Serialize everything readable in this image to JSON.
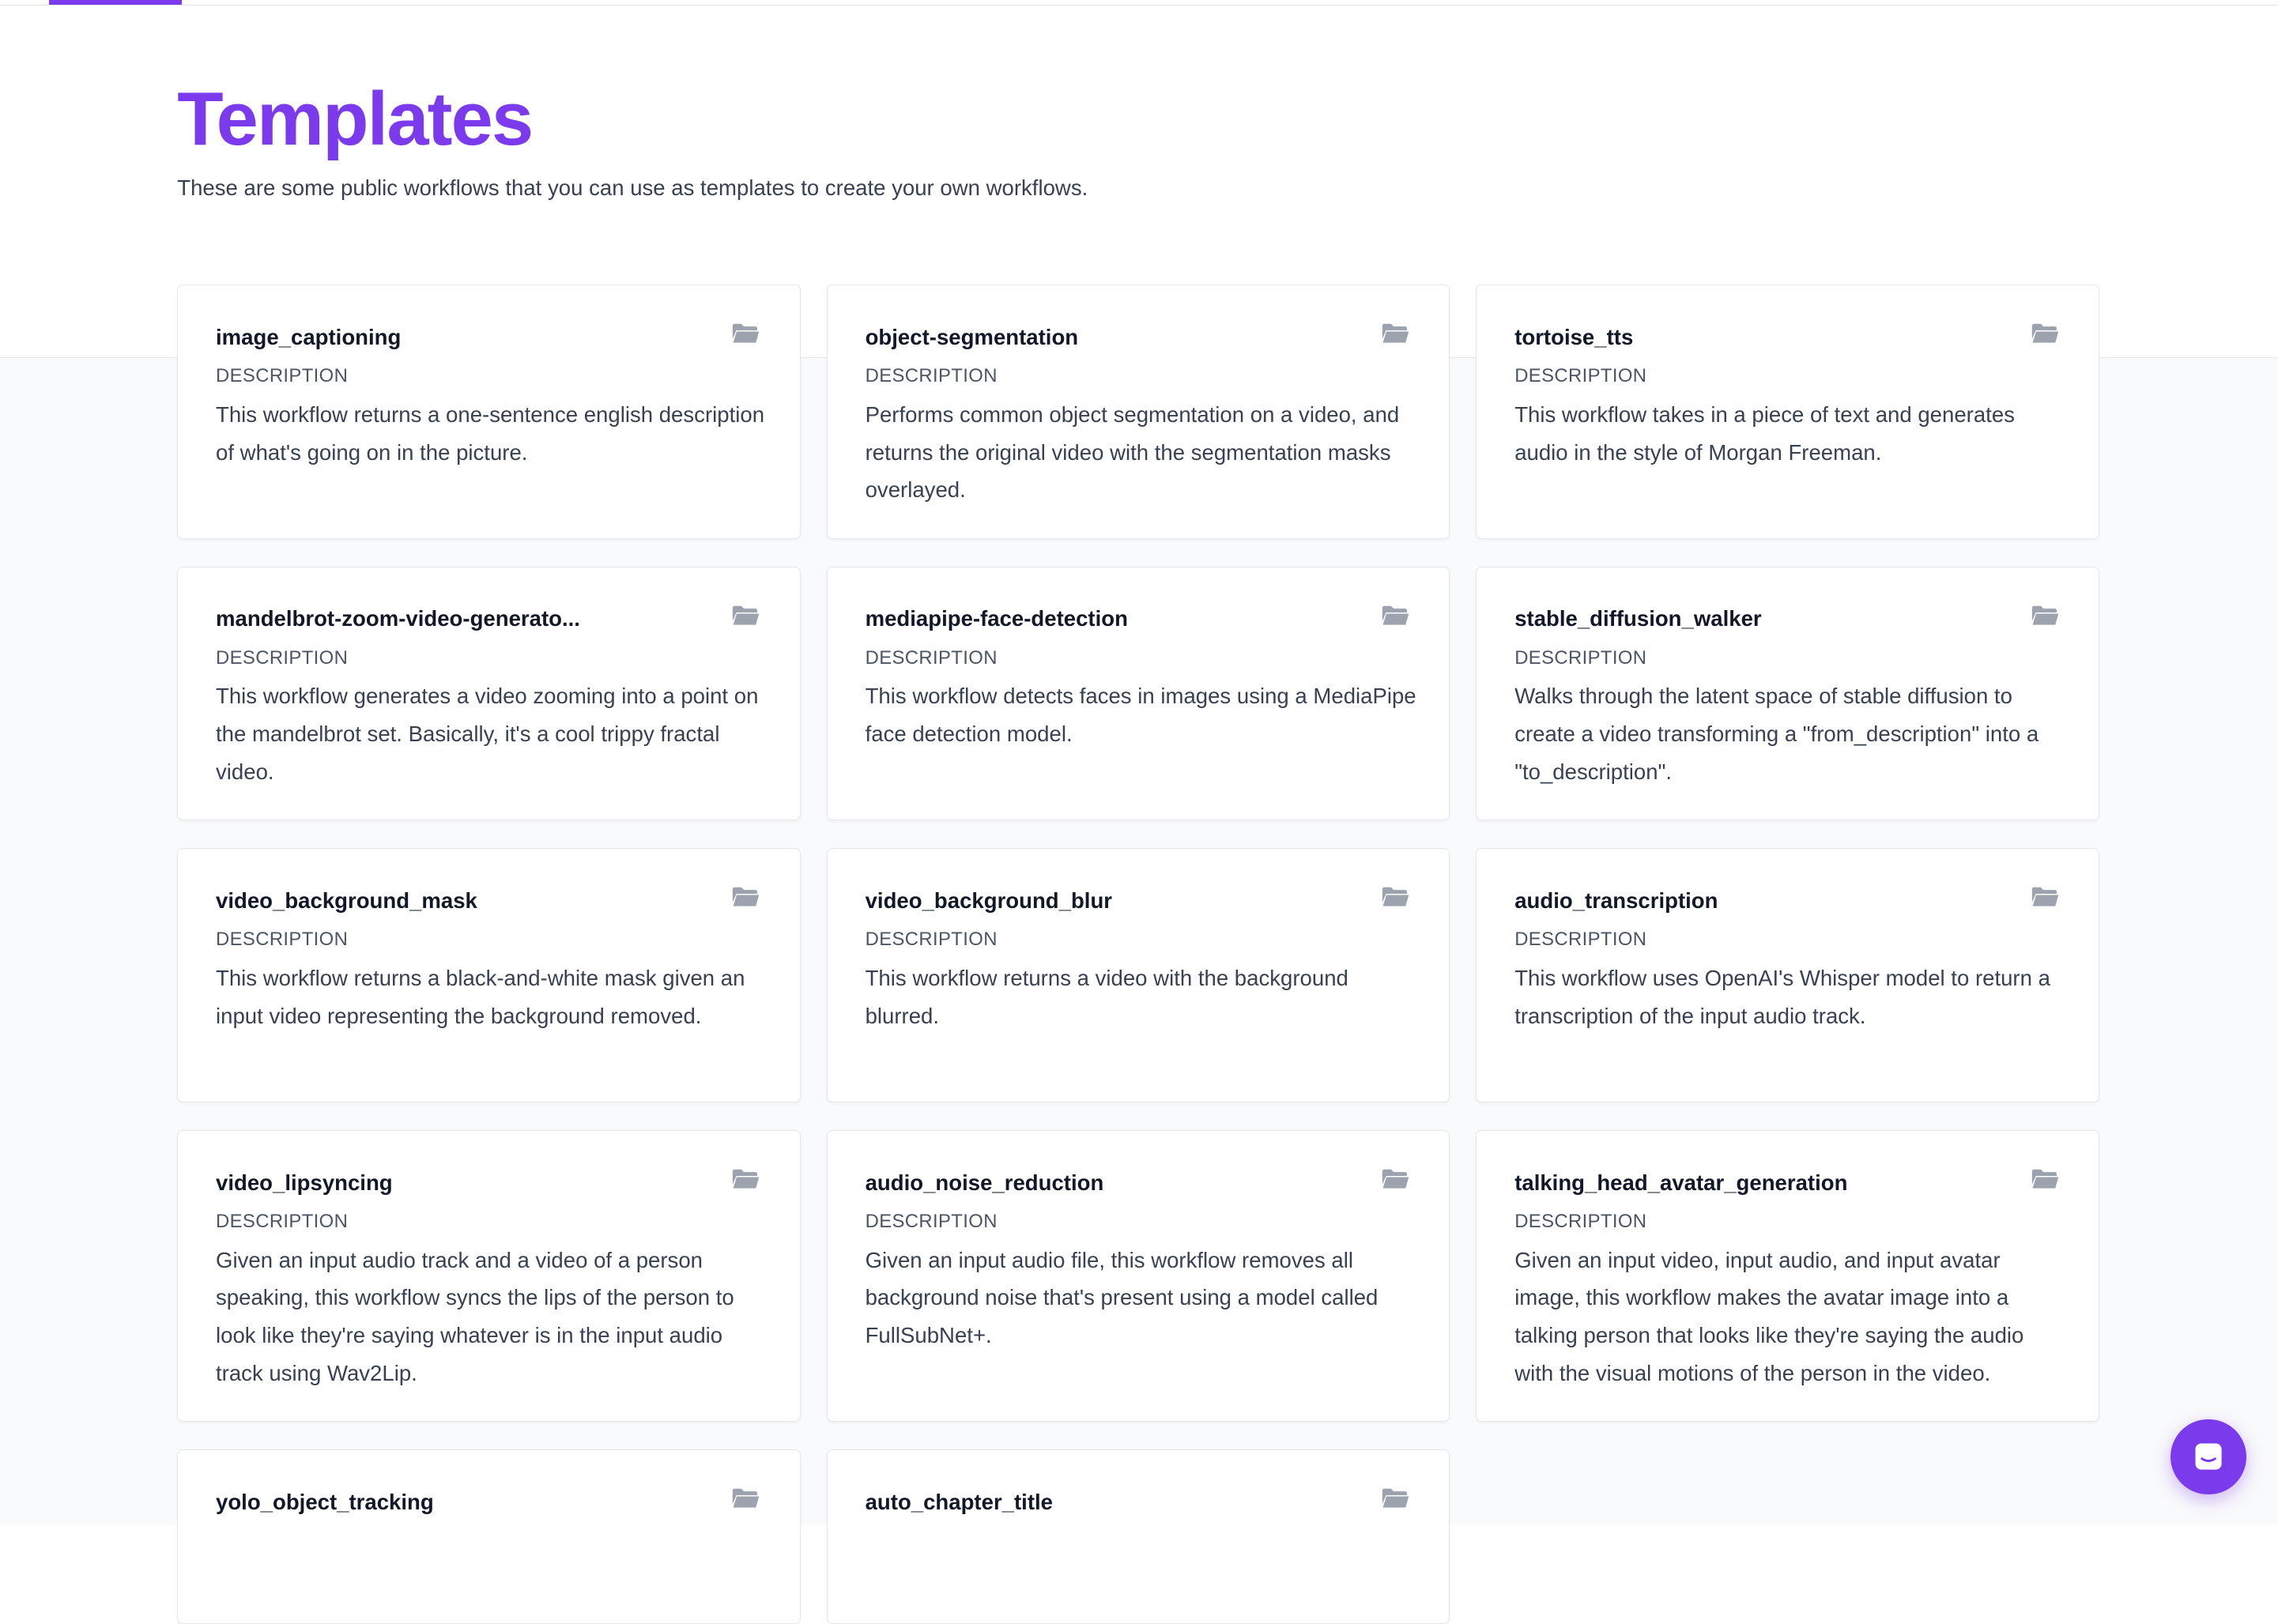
{
  "header": {
    "title": "Templates",
    "subtitle": "These are some public workflows that you can use as templates to create your own workflows."
  },
  "icons": {
    "card": "folder-icon",
    "chat": "chat-icon"
  },
  "colors": {
    "accent": "#7c3aed"
  },
  "templates": [
    {
      "title": "image_captioning",
      "label": "DESCRIPTION",
      "description": "This workflow returns a one-sentence english description of what's going on in the picture."
    },
    {
      "title": "object-segmentation",
      "label": "DESCRIPTION",
      "description": "Performs common object segmentation on a video, and returns the original video with the segmentation masks overlayed."
    },
    {
      "title": "tortoise_tts",
      "label": "DESCRIPTION",
      "description": "This workflow takes in a piece of text and generates audio in the style of Morgan Freeman."
    },
    {
      "title": "mandelbrot-zoom-video-generato...",
      "label": "DESCRIPTION",
      "description": "This workflow generates a video zooming into a point on the mandelbrot set. Basically, it's a cool trippy fractal video."
    },
    {
      "title": "mediapipe-face-detection",
      "label": "DESCRIPTION",
      "description": "This workflow detects faces in images using a MediaPipe face detection model."
    },
    {
      "title": "stable_diffusion_walker",
      "label": "DESCRIPTION",
      "description": "Walks through the latent space of stable diffusion to create a video transforming a \"from_description\" into a \"to_description\"."
    },
    {
      "title": "video_background_mask",
      "label": "DESCRIPTION",
      "description": "This workflow returns a black-and-white mask given an input video representing the background removed."
    },
    {
      "title": "video_background_blur",
      "label": "DESCRIPTION",
      "description": "This workflow returns a video with the background blurred."
    },
    {
      "title": "audio_transcription",
      "label": "DESCRIPTION",
      "description": "This workflow uses OpenAI's Whisper model to return a transcription of the input audio track."
    },
    {
      "title": "video_lipsyncing",
      "label": "DESCRIPTION",
      "description": "Given an input audio track and a video of a person speaking, this workflow syncs the lips of the person to look like they're saying whatever is in the input audio track using Wav2Lip."
    },
    {
      "title": "audio_noise_reduction",
      "label": "DESCRIPTION",
      "description": "Given an input audio file, this workflow removes all background noise that's present using a model called FullSubNet+."
    },
    {
      "title": "talking_head_avatar_generation",
      "label": "DESCRIPTION",
      "description": "Given an input video, input audio, and input avatar image, this workflow makes the avatar image into a talking person that looks like they're saying the audio with the visual motions of the person in the video."
    },
    {
      "title": "yolo_object_tracking",
      "label": "",
      "description": ""
    },
    {
      "title": "auto_chapter_title",
      "label": "",
      "description": ""
    }
  ]
}
